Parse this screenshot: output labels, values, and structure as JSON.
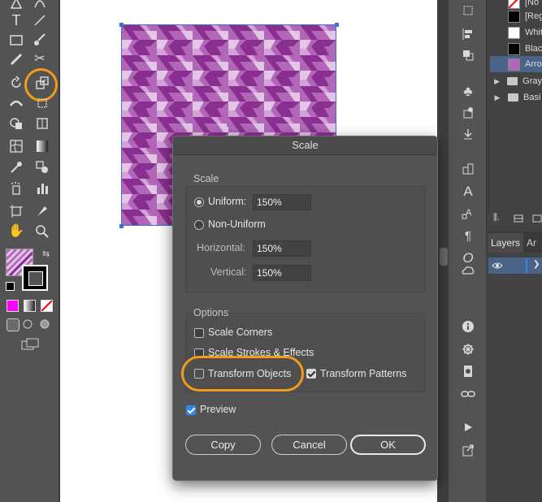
{
  "dialog": {
    "title": "Scale",
    "scale_section_label": "Scale",
    "uniform_label": "Uniform:",
    "uniform_value": "150%",
    "non_uniform_label": "Non-Uniform",
    "horizontal_label": "Horizontal:",
    "horizontal_value": "150%",
    "vertical_label": "Vertical:",
    "vertical_value": "150%",
    "options_section_label": "Options",
    "scale_corners_label": "Scale Corners",
    "scale_strokes_label": "Scale Strokes & Effects",
    "transform_objects_label": "Transform Objects",
    "transform_patterns_label": "Transform Patterns",
    "preview_label": "Preview",
    "copy_label": "Copy",
    "cancel_label": "Cancel",
    "ok_label": "OK",
    "state": {
      "uniform_selected": true,
      "scale_corners": false,
      "scale_strokes": false,
      "transform_objects": false,
      "transform_patterns": true,
      "preview": true
    }
  },
  "swatches_panel": {
    "items": [
      {
        "label": "[No",
        "icon": "none-swatch-icon"
      },
      {
        "label": "[Reg",
        "icon": "registration-swatch-icon"
      },
      {
        "label": "White",
        "color": "#ffffff"
      },
      {
        "label": "Black",
        "color": "#000000"
      },
      {
        "label": "Arro",
        "icon": "pattern-swatch-icon",
        "selected": true
      },
      {
        "label": "Gray",
        "type": "group"
      },
      {
        "label": "Basi",
        "type": "group"
      }
    ]
  },
  "layers_panel": {
    "tabs": [
      "Layers",
      "Ar"
    ],
    "active_tab": "Layers"
  },
  "colors": {
    "highlight_ring": "#f59a1b",
    "pattern_dark": "#8a2f8f",
    "pattern_mid": "#b266b8",
    "pattern_light": "#e2c6e6",
    "selection": "#3d6fd8",
    "active_fill_swatch": "#ff00ff"
  },
  "toolbar": {
    "icons": [
      "pen-icon",
      "line-icon",
      "type-icon",
      "line-segment-icon",
      "rectangle-icon",
      "paintbrush-icon",
      "pencil-icon",
      "scissors-icon",
      "rotate-icon",
      "scale-tool-icon",
      "width-icon",
      "free-transform-icon",
      "shape-builder-icon",
      "perspective-grid-icon",
      "mesh-icon",
      "gradient-icon",
      "eyedropper-icon",
      "blend-icon",
      "symbol-sprayer-icon",
      "column-graph-icon",
      "artboard-icon",
      "slice-icon",
      "hand-icon",
      "zoom-icon"
    ]
  }
}
